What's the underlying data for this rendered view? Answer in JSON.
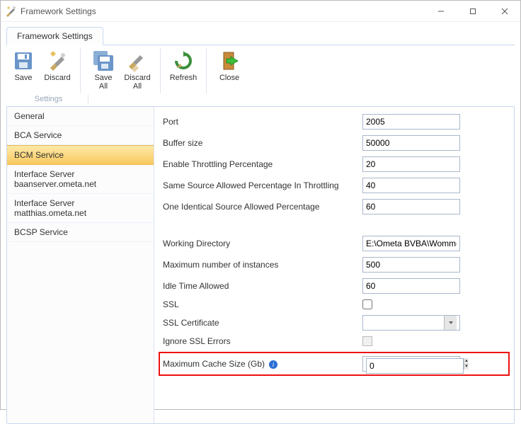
{
  "window": {
    "title": "Framework Settings"
  },
  "tab": {
    "label": "Framework Settings"
  },
  "toolbar": {
    "group_label": "Settings",
    "save": "Save",
    "discard": "Discard",
    "save_all": "Save\nAll",
    "discard_all": "Discard\nAll",
    "refresh": "Refresh",
    "close": "Close"
  },
  "sidebar": {
    "items": [
      {
        "label": "General"
      },
      {
        "label": "BCA Service"
      },
      {
        "label": "BCM Service"
      },
      {
        "label": "Interface Server baanserver.ometa.net"
      },
      {
        "label": "Interface Server matthias.ometa.net"
      },
      {
        "label": "BCSP Service"
      }
    ],
    "selected_index": 2
  },
  "form": {
    "rows": [
      {
        "label": "Port",
        "value": "2005"
      },
      {
        "label": "Buffer size",
        "value": "50000"
      },
      {
        "label": "Enable Throttling Percentage",
        "value": "20"
      },
      {
        "label": "Same Source Allowed Percentage In Throttling",
        "value": "40"
      },
      {
        "label": "One Identical Source Allowed Percentage",
        "value": "60"
      }
    ],
    "rows2": [
      {
        "label": "Working Directory",
        "value": "E:\\Ometa BVBA\\Wommelge"
      },
      {
        "label": "Maximum number of instances",
        "value": "500"
      },
      {
        "label": "Idle Time Allowed",
        "value": "60"
      }
    ],
    "ssl_label": "SSL",
    "ssl_cert_label": "SSL Certificate",
    "ignore_ssl_label": "Ignore SSL Errors",
    "cache_label": "Maximum Cache Size (Gb)",
    "cache_value": "0"
  }
}
